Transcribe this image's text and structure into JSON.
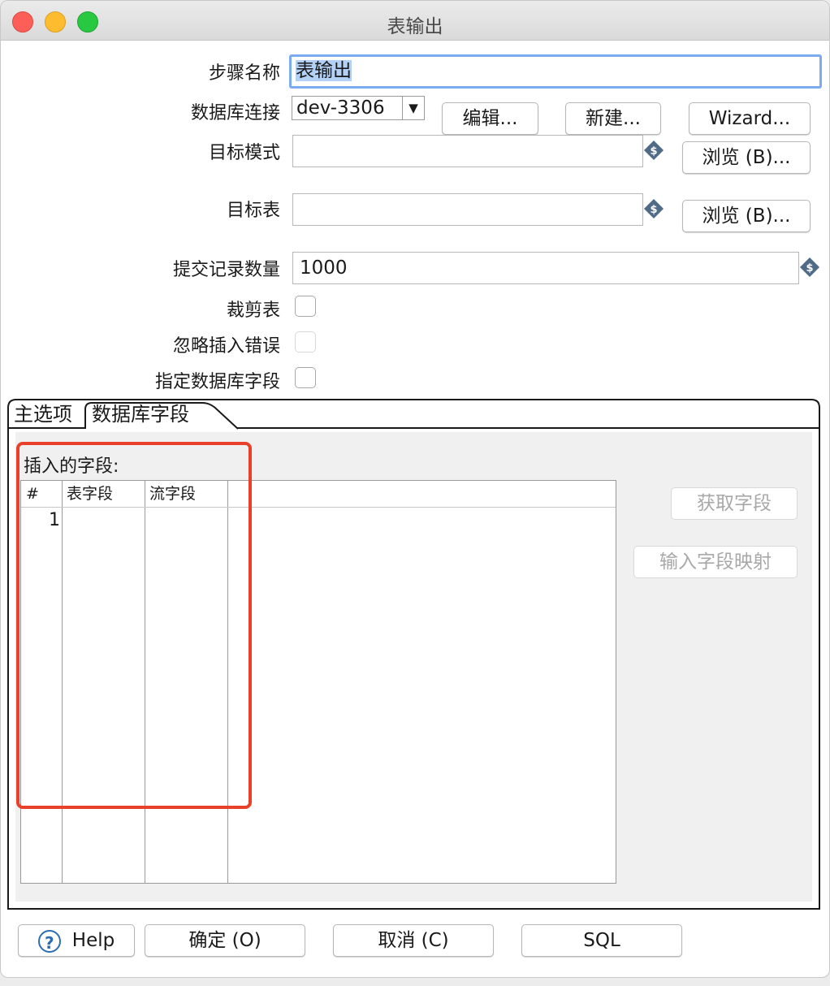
{
  "window": {
    "title": "表输出"
  },
  "form": {
    "step_name_label": "步骤名称",
    "step_name_value": "表输出",
    "db_connection_label": "数据库连接",
    "db_connection_value": "dev-3306",
    "edit_button": "编辑...",
    "new_button": "新建...",
    "wizard_button": "Wizard...",
    "target_schema_label": "目标模式",
    "target_schema_value": "",
    "browse_schema_button": "浏览 (B)...",
    "target_table_label": "目标表",
    "target_table_value": "",
    "browse_table_button": "浏览 (B)...",
    "commit_size_label": "提交记录数量",
    "commit_size_value": "1000",
    "truncate_label": "裁剪表",
    "ignore_errors_label": "忽略插入错误",
    "specify_fields_label": "指定数据库字段"
  },
  "tabs": [
    {
      "label": "主选项"
    },
    {
      "label": "数据库字段"
    }
  ],
  "fields_tab": {
    "insert_fields_label": "插入的字段:",
    "columns": [
      "#",
      "表字段",
      "流字段"
    ],
    "rows": [
      {
        "num": "1",
        "table_field": "",
        "stream_field": ""
      }
    ],
    "get_fields_button": "获取字段",
    "map_fields_button": "输入字段映射"
  },
  "footer": {
    "help_button": "Help",
    "ok_button": "确定 (O)",
    "cancel_button": "取消 (C)",
    "sql_button": "SQL"
  },
  "colors": {
    "highlight_box": "#e8402a",
    "focus_ring": "#7aaaf0",
    "help_icon": "#2f6db0"
  },
  "icons": {
    "variable": "variable-dollar-diamond-icon",
    "help": "question-circle-icon"
  }
}
